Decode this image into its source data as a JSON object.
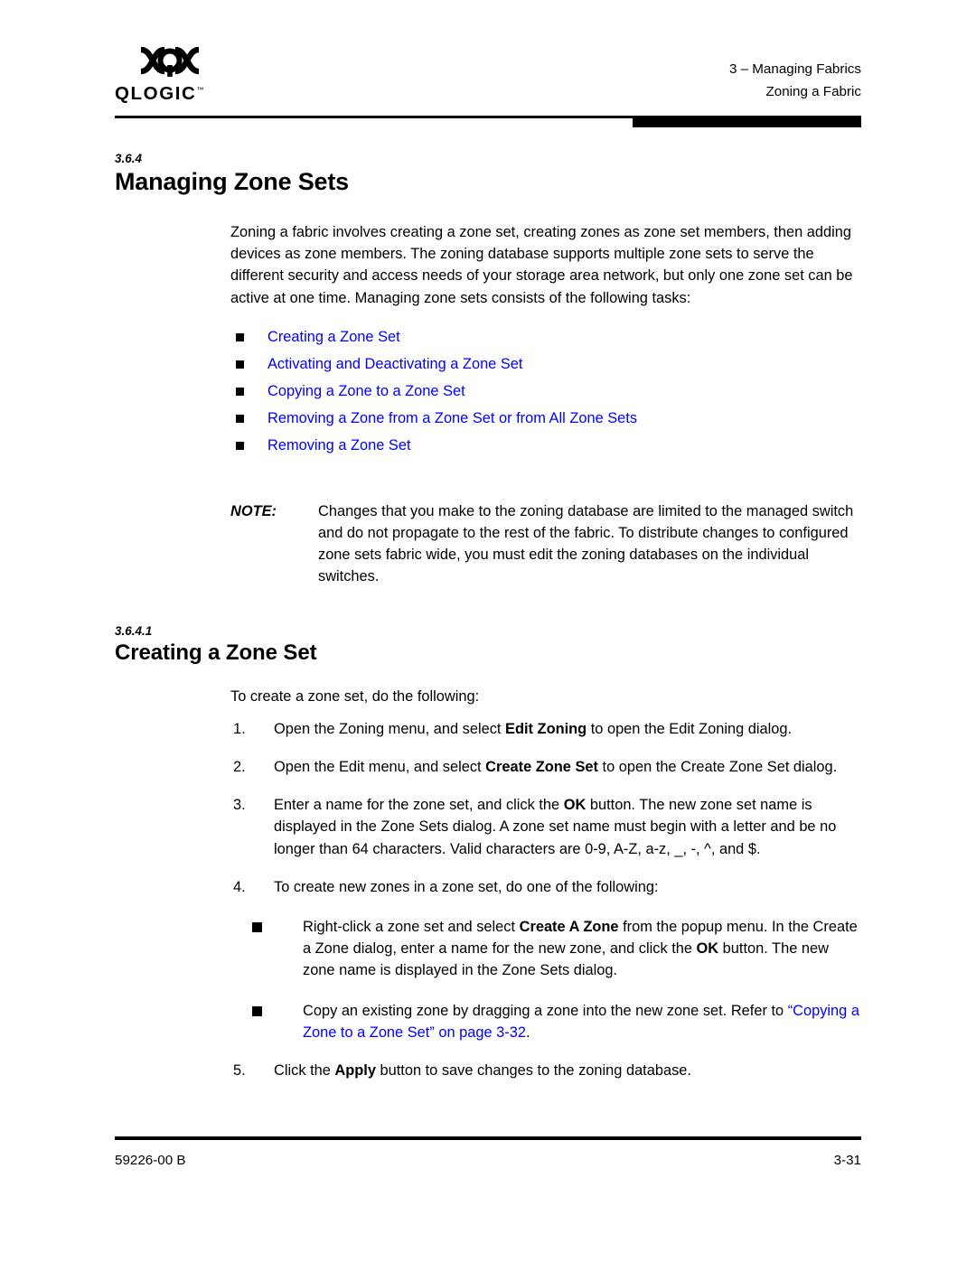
{
  "header": {
    "logo_mark": "qlogic-logo-mark",
    "logo_word": "QLOGIC",
    "logo_tm": "™",
    "chapter": "3 – Managing Fabrics",
    "section": "Zoning a Fabric"
  },
  "sections": [
    {
      "number": "3.6.4",
      "title": "Managing Zone Sets",
      "intro": "Zoning a fabric involves creating a zone set, creating zones as zone set members, then adding devices as zone members. The zoning database supports multiple zone sets to serve the different security and access needs of your storage area network, but only one zone set can be active at one time. Managing zone sets consists of the following tasks:",
      "links": [
        "Creating a Zone Set",
        "Activating and Deactivating a Zone Set",
        "Copying a Zone to a Zone Set",
        "Removing a Zone from a Zone Set or from All Zone Sets",
        "Removing a Zone Set"
      ],
      "note": {
        "label": "NOTE:",
        "text": "Changes that you make to the zoning database are limited to the managed switch and do not propagate to the rest of the fabric. To distribute changes to configured zone sets fabric wide, you must edit the zoning databases on the individual switches."
      }
    },
    {
      "number": "3.6.4.1",
      "title": "Creating a Zone Set",
      "lead": "To create a zone set, do the following:",
      "steps": [
        {
          "num": "1.",
          "parts": [
            {
              "t": "Open the Zoning menu, and select "
            },
            {
              "t": "Edit Zoning",
              "b": true
            },
            {
              "t": " to open the Edit Zoning dialog."
            }
          ]
        },
        {
          "num": "2.",
          "parts": [
            {
              "t": "Open the Edit menu, and select "
            },
            {
              "t": "Create Zone Set",
              "b": true
            },
            {
              "t": " to open the Create Zone Set dialog."
            }
          ]
        },
        {
          "num": "3.",
          "parts": [
            {
              "t": "Enter a name for the zone set, and click the "
            },
            {
              "t": "OK",
              "b": true
            },
            {
              "t": " button. The new zone set name is displayed in the Zone Sets dialog. A zone set name must begin with a letter and be no longer than 64 characters. Valid characters are 0-9, A-Z, a-z, _, -, ^, and $."
            }
          ]
        },
        {
          "num": "4.",
          "parts": [
            {
              "t": "To create new zones in a zone set, do one of the following:"
            }
          ],
          "subs": [
            {
              "parts": [
                {
                  "t": "Right-click a zone set and select "
                },
                {
                  "t": "Create A Zone",
                  "b": true
                },
                {
                  "t": " from the popup menu. In the Create a Zone dialog, enter a name for the new zone, and click the "
                },
                {
                  "t": "OK",
                  "b": true
                },
                {
                  "t": " button. The new zone name is displayed in the Zone Sets dialog."
                }
              ]
            },
            {
              "parts": [
                {
                  "t": "Copy an existing zone by dragging a zone into the new zone set. Refer to "
                },
                {
                  "t": "“Copying a Zone to a Zone Set” on page 3-32",
                  "link": true
                },
                {
                  "t": "."
                }
              ]
            }
          ]
        },
        {
          "num": "5.",
          "parts": [
            {
              "t": "Click the "
            },
            {
              "t": "Apply",
              "b": true
            },
            {
              "t": " button to save changes to the zoning database."
            }
          ]
        }
      ]
    }
  ],
  "footer": {
    "doc_number": "59226-00 B",
    "page_number": "3-31"
  },
  "colors": {
    "link": "#0000ff",
    "text": "#000000",
    "background": "#ffffff"
  }
}
